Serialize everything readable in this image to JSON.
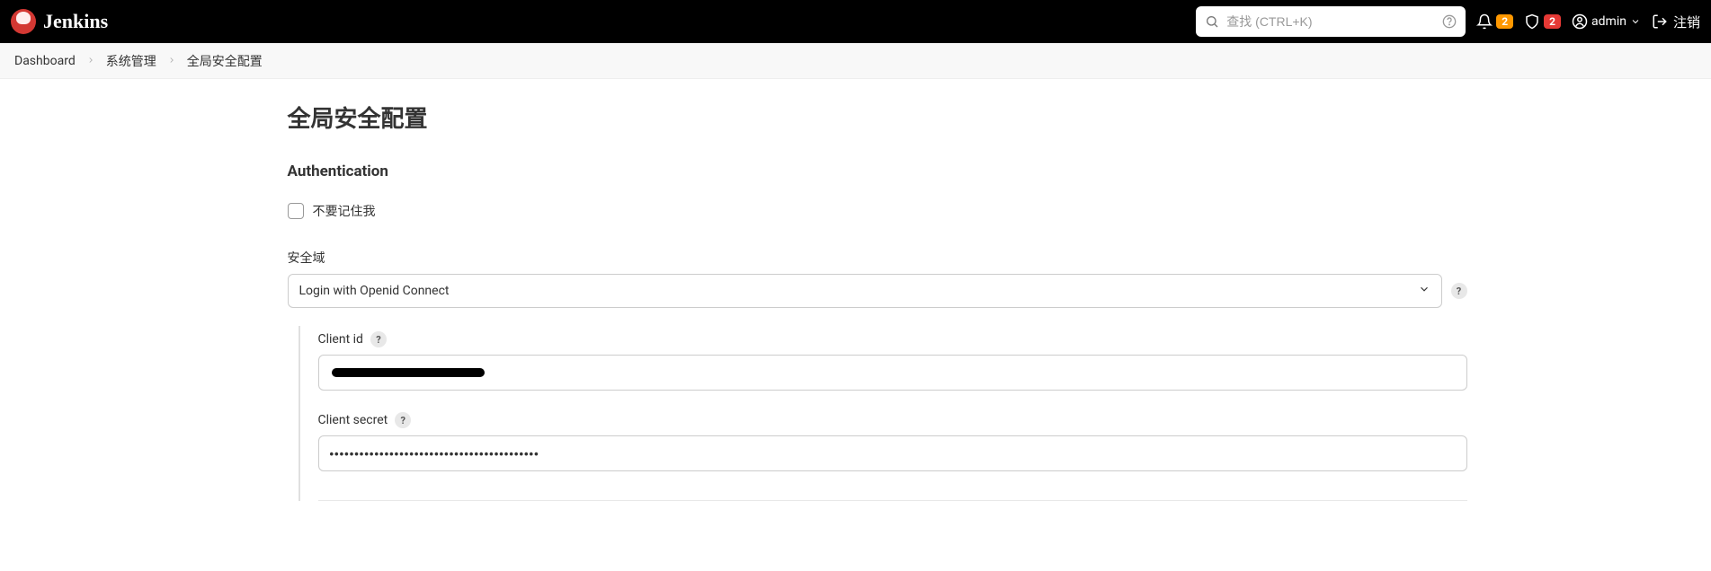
{
  "header": {
    "brand": "Jenkins",
    "search_placeholder": "查找 (CTRL+K)",
    "notifications_count": "2",
    "security_count": "2",
    "user_name": "admin",
    "logout_label": "注销"
  },
  "breadcrumbs": {
    "dashboard": "Dashboard",
    "manage": "系统管理",
    "page": "全局安全配置"
  },
  "page": {
    "title": "全局安全配置",
    "auth_section_title": "Authentication",
    "remember_me_label": "不要记住我",
    "security_realm_label": "安全域",
    "security_realm_value": "Login with Openid Connect",
    "client_id_label": "Client id",
    "client_id_value": "",
    "client_secret_label": "Client secret",
    "client_secret_value": "••••••••••••••••••••••••••••••••••••••••••"
  }
}
